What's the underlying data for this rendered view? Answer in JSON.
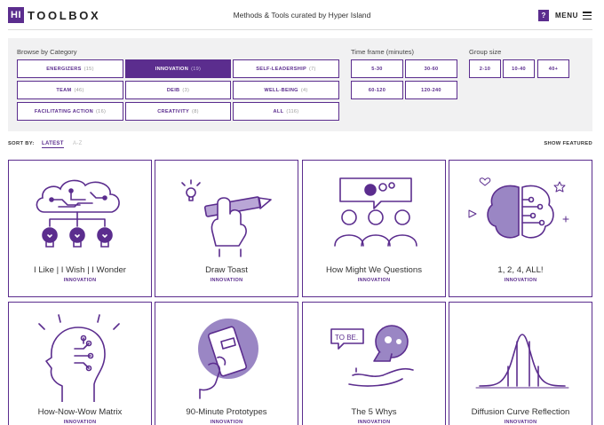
{
  "header": {
    "logo_mark": "HI",
    "logo_text": "TOOLBOX",
    "tagline": "Methods & Tools curated by Hyper Island",
    "help_label": "?",
    "menu_label": "MENU"
  },
  "filters": {
    "category": {
      "title": "Browse by Category",
      "buttons": [
        {
          "label": "ENERGIZERS",
          "count": "(15)",
          "active": false
        },
        {
          "label": "INNOVATION",
          "count": "(19)",
          "active": true
        },
        {
          "label": "SELF-LEADERSHIP",
          "count": "(7)",
          "active": false
        },
        {
          "label": "TEAM",
          "count": "(46)",
          "active": false
        },
        {
          "label": "DEIB",
          "count": "(3)",
          "active": false
        },
        {
          "label": "WELL-BEING",
          "count": "(4)",
          "active": false
        },
        {
          "label": "FACILITATING ACTION",
          "count": "(16)",
          "active": false
        },
        {
          "label": "CREATIVITY",
          "count": "(8)",
          "active": false
        },
        {
          "label": "ALL",
          "count": "(116)",
          "active": false
        }
      ]
    },
    "timeframe": {
      "title": "Time frame (minutes)",
      "buttons": [
        "5-30",
        "30-60",
        "60-120",
        "120-240"
      ]
    },
    "groupsize": {
      "title": "Group size",
      "buttons": [
        "2-10",
        "10-40",
        "40+"
      ]
    }
  },
  "sort": {
    "label": "SORT BY:",
    "latest": "LATEST",
    "az": "A-Z",
    "show_featured": "SHOW FEATURED"
  },
  "cards": [
    {
      "title": "I Like | I Wish | I Wonder",
      "category": "INNOVATION"
    },
    {
      "title": "Draw Toast",
      "category": "INNOVATION"
    },
    {
      "title": "How Might We Questions",
      "category": "INNOVATION"
    },
    {
      "title": "1, 2, 4, ALL!",
      "category": "INNOVATION"
    },
    {
      "title": "How-Now-Wow Matrix",
      "category": "INNOVATION"
    },
    {
      "title": "90-Minute Prototypes",
      "category": "INNOVATION"
    },
    {
      "title": "The 5 Whys",
      "category": "INNOVATION",
      "bubble_text": "TO BE."
    },
    {
      "title": "Diffusion Curve Reflection",
      "category": "INNOVATION"
    }
  ],
  "colors": {
    "accent": "#5b2d8e",
    "accent_light": "#b9a6d6",
    "panel_bg": "#f1f1f2"
  }
}
